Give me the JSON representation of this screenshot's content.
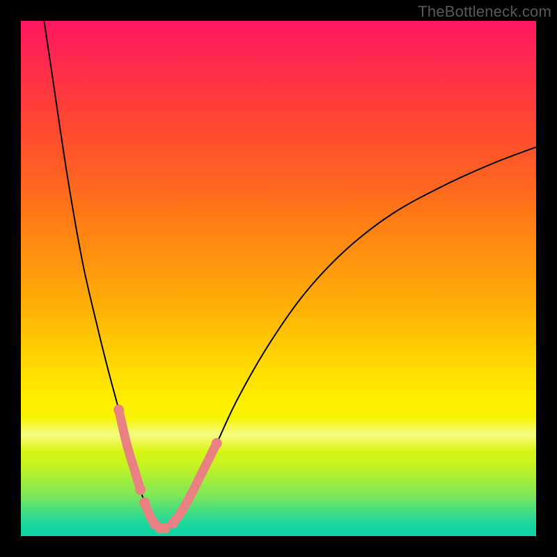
{
  "watermark": "TheBottleneck.com",
  "colors": {
    "frame": "#000000",
    "curve_stroke": "#000000",
    "segment_stroke": "#e98183",
    "segment_fill": "#e98183"
  },
  "chart_data": {
    "type": "line",
    "title": "",
    "xlabel": "",
    "ylabel": "",
    "xlim": [
      0,
      100
    ],
    "ylim": [
      0,
      100
    ],
    "legend": false,
    "grid": false,
    "series": [
      {
        "name": "left-branch",
        "x": [
          4.5,
          6,
          9,
          12,
          15,
          17,
          19,
          20.5,
          22,
          23.2,
          24,
          25,
          26,
          27
        ],
        "y": [
          100,
          90,
          70,
          53,
          40,
          32,
          24.5,
          18,
          13,
          9,
          6.5,
          4,
          2.3,
          1.5
        ]
      },
      {
        "name": "right-branch",
        "x": [
          28,
          29.5,
          31,
          33,
          35,
          38,
          42,
          48,
          55,
          63,
          72,
          82,
          92,
          100
        ],
        "y": [
          1.5,
          2.5,
          4.5,
          8,
          12,
          18,
          26.5,
          37,
          47,
          55.5,
          62.5,
          68,
          72.5,
          75.5
        ]
      },
      {
        "name": "flat-bottom",
        "x": [
          27,
          28
        ],
        "y": [
          1.5,
          1.5
        ]
      }
    ],
    "highlighted_segments": {
      "left_branch_indices": [
        [
          6,
          9
        ],
        [
          10,
          12
        ]
      ],
      "right_branch_indices": [
        [
          1,
          5
        ]
      ],
      "flat_bottom": true,
      "endpoint_dots": true
    },
    "note": "Values are read off the rasterized plot in percent of the axis range. The curve is an unlabelled V-shaped dip: a steep left arm falling from the top-left corner, a flat minimum near x≈27–28 at y≈1.5, and a right arm rising with diminishing slope toward y≈75 at x=100. Short pink rounded segments overlay parts of both arms near the bottom and the flat minimum."
  }
}
